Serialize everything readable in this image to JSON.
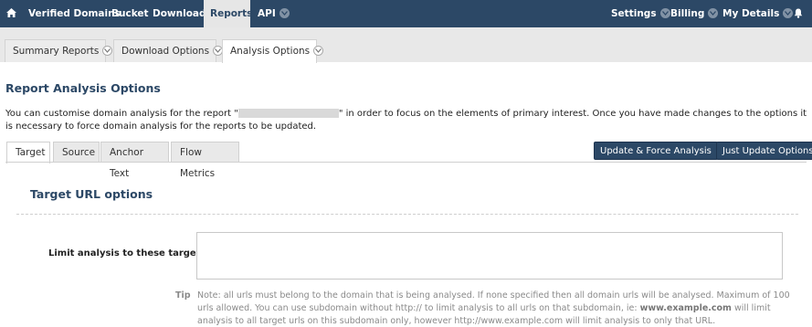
{
  "nav": {
    "home_icon": "home-icon",
    "items": [
      {
        "label": "Verified Domains"
      },
      {
        "label": "Bucket"
      },
      {
        "label": "Downloads"
      },
      {
        "label": "Reports"
      },
      {
        "label": "API"
      }
    ],
    "right": [
      {
        "label": "Settings"
      },
      {
        "label": "Billing"
      },
      {
        "label": "My Details"
      }
    ],
    "bell_icon": "bell-icon"
  },
  "subtabs": [
    {
      "label": "Summary Reports"
    },
    {
      "label": "Download Options"
    },
    {
      "label": "Analysis Options"
    }
  ],
  "page": {
    "title": "Report Analysis Options",
    "desc_before": "You can customise domain analysis for the report \"",
    "desc_after": "\" in order to focus on the elements of primary interest. Once you have made changes to the options it is necessary to force domain analysis for the reports to be updated."
  },
  "tabs": [
    {
      "label": "Target"
    },
    {
      "label": "Source"
    },
    {
      "label": "Anchor Text"
    },
    {
      "label": "Flow Metrics"
    }
  ],
  "buttons": {
    "update_force": "Update & Force Analysis",
    "just_update": "Just Update Options"
  },
  "section": {
    "title": "Target URL options",
    "field_label": "Limit analysis to these target URLs:",
    "field_value": "",
    "tip_label": "Tip",
    "tip_part1": "Note: all urls must belong to the domain that is being analysed. If none specified then all domain urls will be analysed. Maximum of 100 urls allowed. You can use subdomain without http:// to limit analysis to all urls on that subdomain, ie: ",
    "tip_bold": "www.example.com",
    "tip_part2": " will limit analysis to all target urls on this subdomain only, however http://www.example.com will limit analysis to only that URL."
  },
  "colors": {
    "nav_bg": "#2c4866",
    "accent": "#2c4866"
  }
}
